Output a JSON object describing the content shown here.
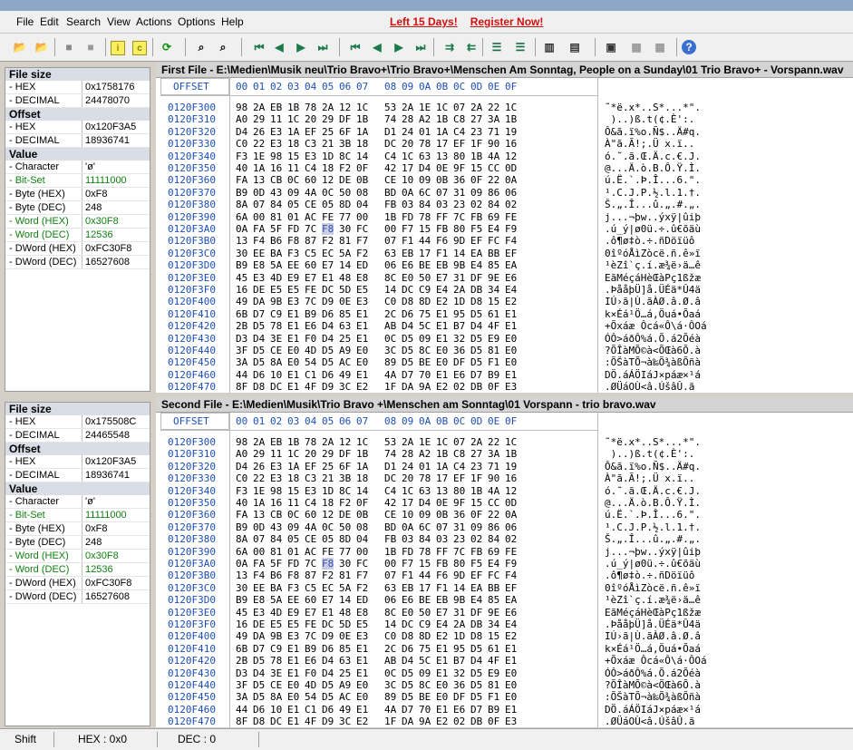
{
  "menu": [
    "File",
    "Edit",
    "Search",
    "View",
    "Actions",
    "Options",
    "Help"
  ],
  "promo": {
    "days": "Left 15 Days!",
    "register": "Register Now!"
  },
  "toolbar_icons": [
    "open-file-1-icon",
    "open-file-2-icon",
    "stop-icon",
    "close-icon",
    "info-icon",
    "compare-icon",
    "refresh-icon",
    "find-icon",
    "find-next-icon",
    "first-diff-icon",
    "prev-diff-icon",
    "next-diff-icon",
    "last-diff-icon",
    "first-icon",
    "prev-icon",
    "next-icon",
    "last-icon",
    "sync-left-icon",
    "sync-right-icon",
    "align-left-icon",
    "align-right-icon",
    "columns-icon",
    "list-icon",
    "report-icon",
    "copy-icon",
    "paste-icon",
    "help-icon"
  ],
  "panel1": {
    "title": "First File - E:\\Medien\\Musik neu\\Trio Bravo+\\Trio Bravo+\\Menschen Am Sonntag, People on a Sunday\\01 Trio Bravo+ - Vorspann.wav",
    "filesize": {
      "hex": "0x1758176",
      "dec": "24478070"
    },
    "offset": {
      "hex": "0x120F3A5",
      "dec": "18936741"
    }
  },
  "panel2": {
    "title": "Second File - E:\\Medien\\Musik\\Trio Bravo +\\Menschen am Sonntag\\01 Vorspann - trio bravo.wav",
    "filesize": {
      "hex": "0x175508C",
      "dec": "24465548"
    },
    "offset": {
      "hex": "0x120F3A5",
      "dec": "18936741"
    }
  },
  "labels": {
    "file_size": "File size",
    "hex": "- HEX",
    "decimal": "- DECIMAL",
    "offset": "Offset",
    "value": "Value"
  },
  "values": [
    {
      "k": "- Character",
      "v": "'ø'",
      "green": false
    },
    {
      "k": "- Bit-Set",
      "v": "11111000",
      "green": true
    },
    {
      "k": "- Byte (HEX)",
      "v": "0xF8",
      "green": false
    },
    {
      "k": "- Byte (DEC)",
      "v": "248",
      "green": false
    },
    {
      "k": "- Word (HEX)",
      "v": "0x30F8",
      "green": true
    },
    {
      "k": "- Word (DEC)",
      "v": "12536",
      "green": true
    },
    {
      "k": "- DWord (HEX)",
      "v": "0xFC30F8",
      "green": false
    },
    {
      "k": "- DWord (DEC)",
      "v": "16527608",
      "green": false
    }
  ],
  "hex_header": {
    "offset_label": "OFFSET",
    "cols": [
      "00",
      "01",
      "02",
      "03",
      "04",
      "05",
      "06",
      "07",
      "08",
      "09",
      "0A",
      "0B",
      "0C",
      "0D",
      "0E",
      "0F"
    ]
  },
  "hex_rows": [
    {
      "off": "0120F300",
      "hex": [
        "98",
        "2A",
        "EB",
        "1B",
        "78",
        "2A",
        "12",
        "1C",
        "53",
        "2A",
        "1E",
        "1C",
        "07",
        "2A",
        "22",
        "1C"
      ],
      "asc": "˜*ë.x*..S*...*\"."
    },
    {
      "off": "0120F310",
      "hex": [
        "A0",
        "29",
        "11",
        "1C",
        "20",
        "29",
        "DF",
        "1B",
        "74",
        "28",
        "A2",
        "1B",
        "C8",
        "27",
        "3A",
        "1B"
      ],
      "asc": " )..)ß.t(¢.È':."
    },
    {
      "off": "0120F320",
      "hex": [
        "D4",
        "26",
        "E3",
        "1A",
        "EF",
        "25",
        "6F",
        "1A",
        "D1",
        "24",
        "01",
        "1A",
        "C4",
        "23",
        "71",
        "19"
      ],
      "asc": "Ô&ã.ï%o.Ñ$..Ä#q."
    },
    {
      "off": "0120F330",
      "hex": [
        "C0",
        "22",
        "E3",
        "18",
        "C3",
        "21",
        "3B",
        "18",
        "DC",
        "20",
        "78",
        "17",
        "EF",
        "1F",
        "90",
        "16"
      ],
      "asc": "À\"ã.Ã!;.Ü x.ï.."
    },
    {
      "off": "0120F340",
      "hex": [
        "F3",
        "1E",
        "98",
        "15",
        "E3",
        "1D",
        "8C",
        "14",
        "C4",
        "1C",
        "63",
        "13",
        "80",
        "1B",
        "4A",
        "12"
      ],
      "asc": "ó.˜.ã.Œ.Ä.c.€.J."
    },
    {
      "off": "0120F350",
      "hex": [
        "40",
        "1A",
        "16",
        "11",
        "C4",
        "18",
        "F2",
        "0F",
        "42",
        "17",
        "D4",
        "0E",
        "9F",
        "15",
        "CC",
        "0D"
      ],
      "asc": "@...Ä.ò.B.Ô.Ÿ.Ì."
    },
    {
      "off": "0120F360",
      "hex": [
        "FA",
        "13",
        "CB",
        "0C",
        "60",
        "12",
        "DE",
        "0B",
        "CE",
        "10",
        "09",
        "0B",
        "36",
        "0F",
        "22",
        "0A"
      ],
      "asc": "ú.Ë.`.Þ.Î...6.\"."
    },
    {
      "off": "0120F370",
      "hex": [
        "B9",
        "0D",
        "43",
        "09",
        "4A",
        "0C",
        "50",
        "08",
        "BD",
        "0A",
        "6C",
        "07",
        "31",
        "09",
        "86",
        "06"
      ],
      "asc": "¹.C.J.P.½.l.1.†."
    },
    {
      "off": "0120F380",
      "hex": [
        "8A",
        "07",
        "84",
        "05",
        "CE",
        "05",
        "8D",
        "04",
        "FB",
        "03",
        "84",
        "03",
        "23",
        "02",
        "84",
        "02"
      ],
      "asc": "Š.„.Î...û.„.#.„."
    },
    {
      "off": "0120F390",
      "hex": [
        "6A",
        "00",
        "81",
        "01",
        "AC",
        "FE",
        "77",
        "00",
        "1B",
        "FD",
        "78",
        "FF",
        "7C",
        "FB",
        "69",
        "FE"
      ],
      "asc": "j...¬þw..ýxÿ|ûiþ"
    },
    {
      "off": "0120F3A0",
      "hex": [
        "0A",
        "FA",
        "5F",
        "FD",
        "7C",
        "F8",
        "30",
        "FC",
        "00",
        "F7",
        "15",
        "FB",
        "80",
        "F5",
        "E4",
        "F9"
      ],
      "asc": ".ú_ý|ø0ü.÷.û€õäù",
      "hl": 5
    },
    {
      "off": "0120F3B0",
      "hex": [
        "13",
        "F4",
        "B6",
        "F8",
        "87",
        "F2",
        "81",
        "F7",
        "07",
        "F1",
        "44",
        "F6",
        "9D",
        "EF",
        "FC",
        "F4"
      ],
      "asc": ".ô¶ø‡ò.÷.ñDöïüô"
    },
    {
      "off": "0120F3C0",
      "hex": [
        "30",
        "EE",
        "BA",
        "F3",
        "C5",
        "EC",
        "5A",
        "F2",
        "63",
        "EB",
        "17",
        "F1",
        "14",
        "EA",
        "BB",
        "EF"
      ],
      "asc": "0îºóÅìZòcë.ñ.ê»ï"
    },
    {
      "off": "0120F3D0",
      "hex": [
        "B9",
        "E8",
        "5A",
        "EE",
        "60",
        "E7",
        "14",
        "ED",
        "06",
        "E6",
        "BE",
        "EB",
        "9B",
        "E4",
        "85",
        "EA"
      ],
      "asc": "¹èZî`ç.í.æ¾ë›ä…ê"
    },
    {
      "off": "0120F3E0",
      "hex": [
        "45",
        "E3",
        "4D",
        "E9",
        "E7",
        "E1",
        "48",
        "E8",
        "8C",
        "E0",
        "50",
        "E7",
        "31",
        "DF",
        "9E",
        "E6"
      ],
      "asc": "EãMéçáHèŒàPç1ßžæ"
    },
    {
      "off": "0120F3F0",
      "hex": [
        "16",
        "DE",
        "E5",
        "E5",
        "FE",
        "DC",
        "5D",
        "E5",
        "14",
        "DC",
        "C9",
        "E4",
        "2A",
        "DB",
        "34",
        "E4"
      ],
      "asc": ".ÞååþÜ]å.ÜÉä*Û4ä"
    },
    {
      "off": "0120F400",
      "hex": [
        "49",
        "DA",
        "9B",
        "E3",
        "7C",
        "D9",
        "0E",
        "E3",
        "C0",
        "D8",
        "8D",
        "E2",
        "1D",
        "D8",
        "15",
        "E2"
      ],
      "asc": "IÚ›ã|Ù.ãÀØ.â.Ø.â"
    },
    {
      "off": "0120F410",
      "hex": [
        "6B",
        "D7",
        "C9",
        "E1",
        "B9",
        "D6",
        "85",
        "E1",
        "2C",
        "D6",
        "75",
        "E1",
        "95",
        "D5",
        "61",
        "E1"
      ],
      "asc": "k×Éá¹Ö…á,Öuá•Õaá"
    },
    {
      "off": "0120F420",
      "hex": [
        "2B",
        "D5",
        "78",
        "E1",
        "E6",
        "D4",
        "63",
        "E1",
        "AB",
        "D4",
        "5C",
        "E1",
        "B7",
        "D4",
        "4F",
        "E1"
      ],
      "asc": "+Õxáæ Ôcá«Ô\\á·ÔOá"
    },
    {
      "off": "0120F430",
      "hex": [
        "D3",
        "D4",
        "3E",
        "E1",
        "F0",
        "D4",
        "25",
        "E1",
        "0C",
        "D5",
        "09",
        "E1",
        "32",
        "D5",
        "E9",
        "E0"
      ],
      "asc": "ÓÔ>áðÔ%á.Õ.á2Õéà"
    },
    {
      "off": "0120F440",
      "hex": [
        "3F",
        "D5",
        "CE",
        "E0",
        "4D",
        "D5",
        "A9",
        "E0",
        "3C",
        "D5",
        "8C",
        "E0",
        "36",
        "D5",
        "81",
        "E0"
      ],
      "asc": "?ÕÎàMÕ©à<ÕŒà6Õ.à"
    },
    {
      "off": "0120F450",
      "hex": [
        "3A",
        "D5",
        "8A",
        "E0",
        "54",
        "D5",
        "AC",
        "E0",
        "89",
        "D5",
        "BE",
        "E0",
        "DF",
        "D5",
        "F1",
        "E0"
      ],
      "asc": ":ÕŠàTÕ¬à‰Õ¾àßÕñà"
    },
    {
      "off": "0120F460",
      "hex": [
        "44",
        "D6",
        "10",
        "E1",
        "C1",
        "D6",
        "49",
        "E1",
        "4A",
        "D7",
        "70",
        "E1",
        "E6",
        "D7",
        "B9",
        "E1"
      ],
      "asc": "DÖ.áÁÖIáJ×páæ×¹á"
    },
    {
      "off": "0120F470",
      "hex": [
        "8F",
        "D8",
        "DC",
        "E1",
        "4F",
        "D9",
        "3C",
        "E2",
        "1F",
        "DA",
        "9A",
        "E2",
        "02",
        "DB",
        "0F",
        "E3"
      ],
      "asc": ".ØÜáOÙ<â.ÚšâÛ.ã"
    }
  ],
  "status": {
    "shift": "Shift",
    "hex": "HEX : 0x0",
    "dec": "DEC : 0"
  }
}
